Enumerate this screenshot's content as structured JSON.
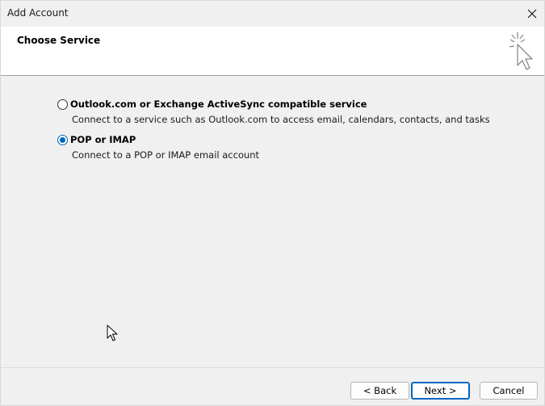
{
  "window": {
    "title": "Add Account",
    "close_icon": "close-icon"
  },
  "header": {
    "title": "Choose Service",
    "icon": "pointer-click-icon"
  },
  "options": [
    {
      "label": "Outlook.com or Exchange ActiveSync compatible service",
      "description": "Connect to a service such as Outlook.com to access email, calendars, contacts, and tasks",
      "selected": false
    },
    {
      "label": "POP or IMAP",
      "description": "Connect to a POP or IMAP email account",
      "selected": true
    }
  ],
  "footer": {
    "back_label": "< Back",
    "next_label": "Next >",
    "cancel_label": "Cancel"
  },
  "colors": {
    "accent": "#0067c0",
    "background": "#f0f0f0",
    "header_background": "#ffffff"
  }
}
